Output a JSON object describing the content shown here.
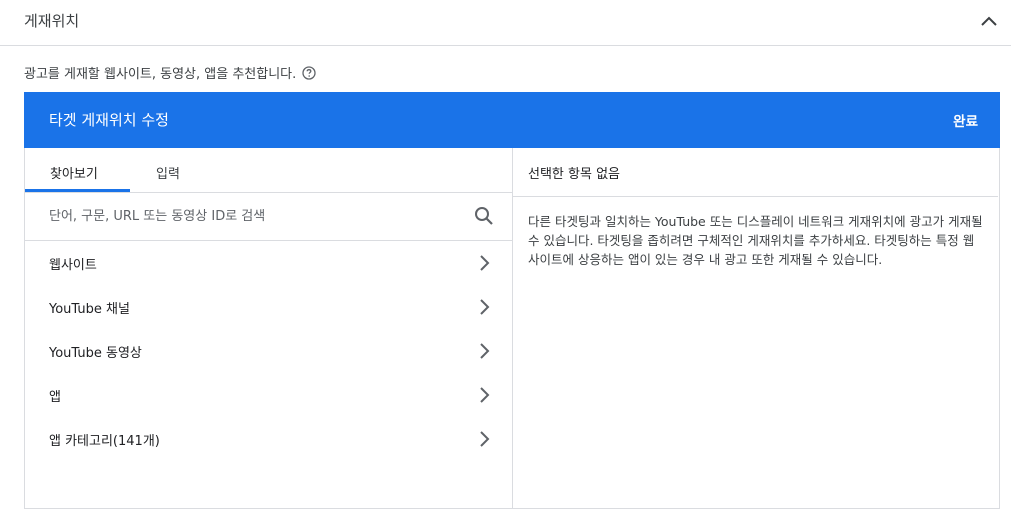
{
  "section": {
    "title": "게재위치",
    "collapse_icon": "chevron-up-icon"
  },
  "description": {
    "text": "광고를 게재할 웹사이트, 동영상, 앱을 추천합니다.",
    "help_icon": "help-circle-icon"
  },
  "editor": {
    "title": "타겟 게재위치 수정",
    "done_label": "완료",
    "accent_color": "#1a73e8"
  },
  "left_panel": {
    "tabs": [
      {
        "label": "찾아보기",
        "active": true
      },
      {
        "label": "입력",
        "active": false
      }
    ],
    "search": {
      "placeholder": "단어, 구문, URL 또는 동영상 ID로 검색",
      "value": "",
      "icon": "search-icon"
    },
    "items": [
      {
        "label": "웹사이트",
        "icon": "chevron-right-icon"
      },
      {
        "label": "YouTube 채널",
        "icon": "chevron-right-icon"
      },
      {
        "label": "YouTube 동영상",
        "icon": "chevron-right-icon"
      },
      {
        "label": "앱",
        "icon": "chevron-right-icon"
      },
      {
        "label": "앱 카테고리(141개)",
        "icon": "chevron-right-icon"
      }
    ]
  },
  "right_panel": {
    "header": "선택한 항목 없음",
    "body": "다른 타겟팅과 일치하는 YouTube 또는 디스플레이 네트워크 게재위치에 광고가 게재될 수 있습니다. 타겟팅을 좁히려면 구체적인 게재위치를 추가하세요. 타겟팅하는 특정 웹사이트에 상응하는 앱이 있는 경우 내 광고 또한 게재될 수 있습니다."
  }
}
